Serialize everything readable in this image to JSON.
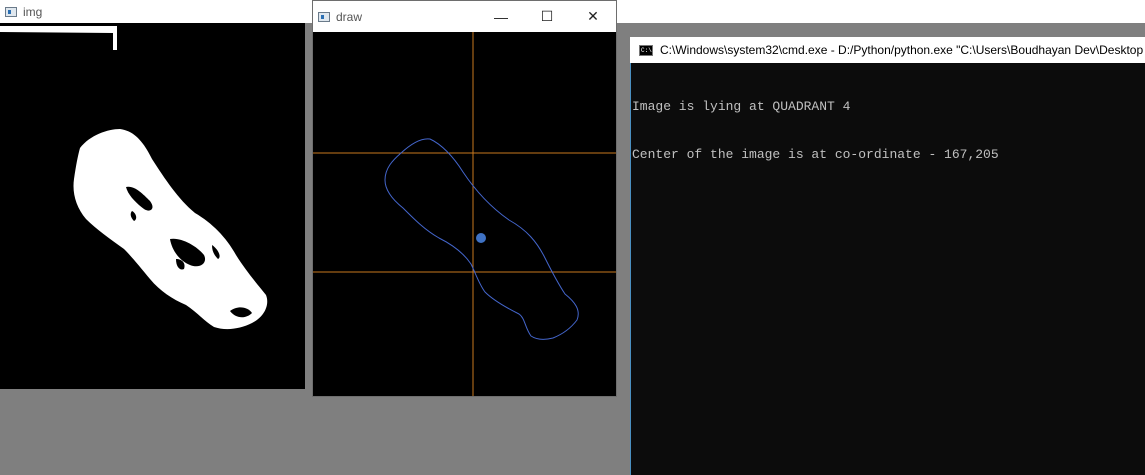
{
  "windows": {
    "img": {
      "title": "img"
    },
    "draw": {
      "title": "draw",
      "controls": {
        "minimize": "—",
        "maximize": "☐",
        "close": "✕"
      }
    },
    "cmd": {
      "title": "C:\\Windows\\system32\\cmd.exe - D:/Python/python.exe  \"C:\\Users\\Boudhayan Dev\\Desktop",
      "icon_text": "C:\\",
      "output": [
        "Image is lying at QUADRANT 4",
        "Center of the image is at co-ordinate - 167,205"
      ]
    }
  },
  "colors": {
    "guide_lines": "#c8781e",
    "contour": "#4466cc",
    "center_dot": "#3f72c4",
    "mask": "#ffffff",
    "desktop": "#7f7f7f"
  }
}
